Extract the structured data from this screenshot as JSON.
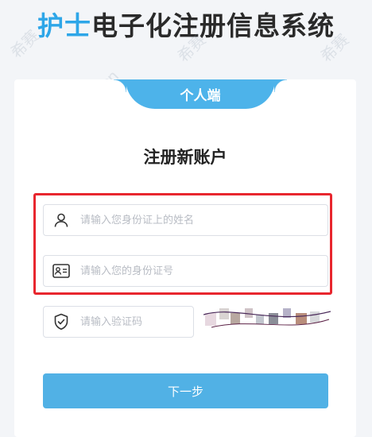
{
  "header": {
    "title_highlight": "护士",
    "title_rest": "电子化注册信息系统"
  },
  "watermark": {
    "text_cn": "希赛",
    "text_url": "www.educity.cn"
  },
  "card": {
    "tab_label": "个人端",
    "heading": "注册新账户",
    "fields": {
      "name": {
        "placeholder": "请输入您身份证上的姓名",
        "value": "",
        "icon": "user-icon"
      },
      "id_number": {
        "placeholder": "请输入您的身份证号",
        "value": "",
        "icon": "id-card-icon"
      },
      "captcha": {
        "placeholder": "请输入验证码",
        "value": "",
        "icon": "shield-check-icon"
      }
    },
    "next_button": "下一步"
  },
  "colors": {
    "accent": "#4db3ea",
    "highlight_frame": "#e8262e",
    "button": "#51b1e5"
  }
}
